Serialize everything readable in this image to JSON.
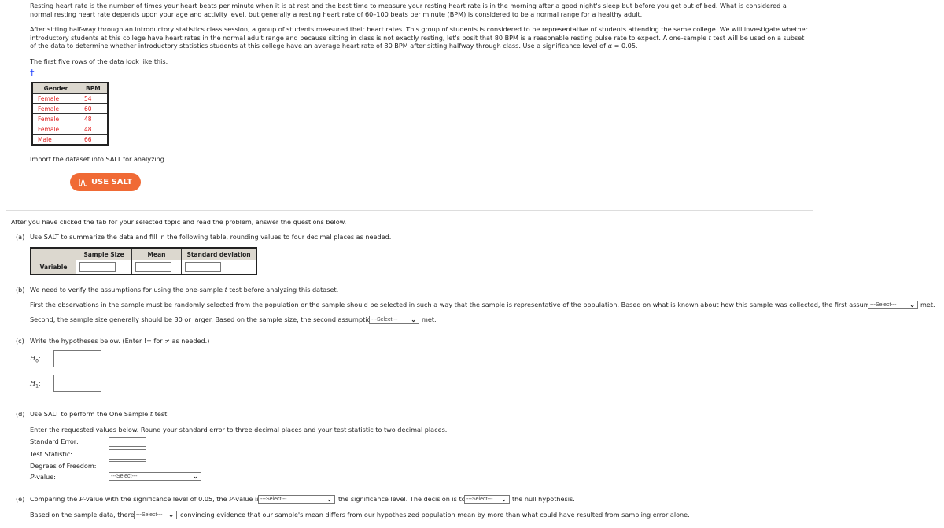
{
  "intro": {
    "p1": "Resting heart rate is the number of times your heart beats per minute when it is at rest and the best time to measure your resting heart rate is in the morning after a good night's sleep but before you get out of bed. What is considered a normal resting heart rate depends upon your age and activity level, but generally a resting heart rate of 60–100 beats per minute (BPM) is considered to be a normal range for a healthy adult.",
    "p2a": "After sitting half-way through an introductory statistics class session, a group of students measured their heart rates. This group of students is considered to be representative of students attending the same college. We will investigate whether introductory students at this college have heart rates in the normal adult range and because sitting in class is not exactly resting, let's posit that 80 BPM is a reasonable resting pulse rate to expect. A one-sample ",
    "p2t": "t",
    "p2b": " test will be used on a subset of the data to determine whether introductory statistics students at this college have an average heart rate of 80 BPM after sitting halfway through class. Use a significance level of ",
    "p2alpha": "α",
    "p2c": " = 0.05.",
    "p3": "The first five rows of the data look like this.",
    "dagger": "†"
  },
  "data_table": {
    "headers": [
      "Gender",
      "BPM"
    ],
    "rows": [
      [
        "Female",
        "54"
      ],
      [
        "Female",
        "60"
      ],
      [
        "Female",
        "48"
      ],
      [
        "Female",
        "48"
      ],
      [
        "Male",
        "66"
      ]
    ]
  },
  "import_text": "Import the dataset into SALT for analyzing.",
  "salt_button": {
    "label": "USE SALT",
    "color": "#f06a35"
  },
  "instructions": "After you have clicked the tab for your selected topic and read the problem, answer the questions below.",
  "part_a": {
    "label": "(a)",
    "text": "Use SALT to summarize the data and fill in the following table, rounding values to four decimal places as needed.",
    "headers": [
      "Sample Size",
      "Mean",
      "Standard deviation"
    ],
    "row_label": "Variable"
  },
  "part_b": {
    "label": "(b)",
    "text_a": "We need to verify the assumptions for using the one-sample ",
    "text_t": "t",
    "text_b": " test before analyzing this dataset.",
    "first": "First the observations in the sample must be randomly selected from the population or the sample should be selected in such a way that the sample is representative of the population. Based on what is known about how this sample was collected, the first assumption",
    "second": "Second, the sample size generally should be 30 or larger. Based on the sample size, the second assumption",
    "met": "met.",
    "select": "---Select---"
  },
  "part_c": {
    "label": "(c)",
    "text": "Write the hypotheses below. (Enter != for ≠ as needed.)",
    "h0": "H",
    "h0_sub": "0",
    "h1": "H",
    "h1_sub": "1",
    "colon": ":"
  },
  "part_d": {
    "label": "(d)",
    "text_a": "Use SALT to perform the One Sample ",
    "text_t": "t",
    "text_b": " test.",
    "enter": "Enter the requested values below. Round your standard error to three decimal places and your test statistic to two decimal places.",
    "se": "Standard Error:",
    "ts": "Test Statistic:",
    "df": "Degrees of Freedom:",
    "p_italic": "P",
    "p_rest": "-value:",
    "select": "---Select---"
  },
  "part_e": {
    "label": "(e)",
    "t1": "Comparing the ",
    "t1p": "P",
    "t2": "-value with the significance level of 0.05, the ",
    "t2p": "P",
    "t3": "-value is",
    "t4": "the significance level. The decision is to",
    "t5": "the null hypothesis.",
    "b1": "Based on the sample data, there",
    "b2": "convincing evidence that our sample's mean differs from our hypothesized population mean by more than what could have resulted from sampling error alone.",
    "select": "---Select---"
  }
}
